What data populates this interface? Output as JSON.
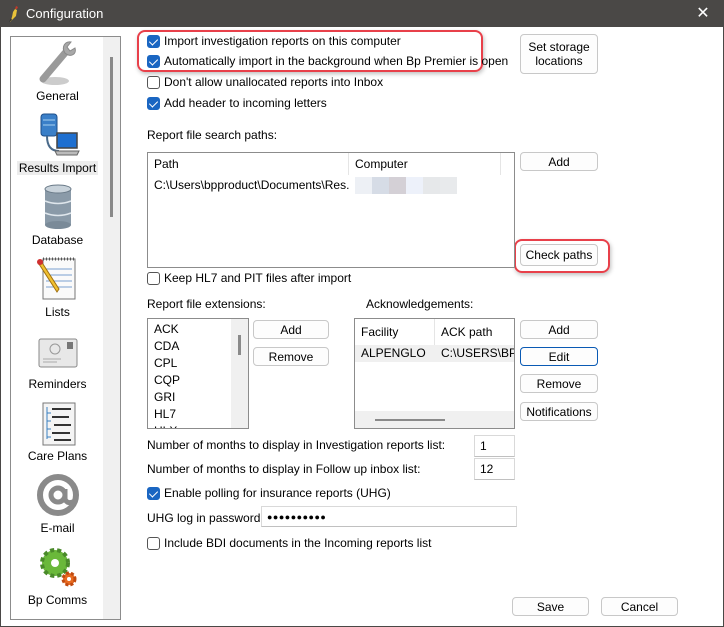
{
  "window": {
    "title": "Configuration",
    "close_glyph": "✕"
  },
  "sidebar": {
    "items": [
      {
        "label": "General",
        "icon": "wrench-icon"
      },
      {
        "label": "Results Import",
        "icon": "server-computer-icon",
        "selected": true
      },
      {
        "label": "Database",
        "icon": "database-icon"
      },
      {
        "label": "Lists",
        "icon": "notepad-pencil-icon"
      },
      {
        "label": "Reminders",
        "icon": "envelope-icon"
      },
      {
        "label": "Care Plans",
        "icon": "tree-document-icon"
      },
      {
        "label": "E-mail",
        "icon": "at-sign-icon"
      },
      {
        "label": "Bp Comms",
        "icon": "gears-icon"
      }
    ]
  },
  "options": {
    "import_on_computer": {
      "label": "Import investigation reports on this computer",
      "checked": true
    },
    "auto_import_background": {
      "label": "Automatically import in the background when Bp Premier is open",
      "checked": true
    },
    "no_unallocated": {
      "label": "Don't allow unallocated reports into Inbox",
      "checked": false
    },
    "add_header": {
      "label": "Add header to incoming letters",
      "checked": true
    },
    "keep_hl7": {
      "label": "Keep HL7 and PIT files after import",
      "checked": false
    },
    "enable_polling": {
      "label": "Enable polling for insurance reports (UHG)",
      "checked": true
    },
    "include_bdi": {
      "label": "Include BDI documents in the Incoming reports list",
      "checked": false
    }
  },
  "buttons": {
    "set_storage": "Set storage locations",
    "paths_add": "Add",
    "check_paths": "Check paths",
    "ext_add": "Add",
    "ext_remove": "Remove",
    "ack_add": "Add",
    "ack_edit": "Edit",
    "ack_remove": "Remove",
    "ack_notifications": "Notifications",
    "save": "Save",
    "cancel": "Cancel"
  },
  "search_paths": {
    "label": "Report file search paths:",
    "columns": [
      "Path",
      "Computer"
    ],
    "rows": [
      {
        "path": "C:\\Users\\bpproduct\\Documents\\Res...",
        "computer": "(redacted)"
      }
    ]
  },
  "extensions": {
    "label": "Report file extensions:",
    "items": [
      "ACK",
      "CDA",
      "CPL",
      "CQP",
      "GRI",
      "HL7",
      "HLX"
    ]
  },
  "acknowledgements": {
    "label": "Acknowledgements:",
    "columns": [
      "Facility",
      "ACK path"
    ],
    "rows": [
      {
        "facility": "ALPENGLO",
        "ack_path": "C:\\USERS\\BP"
      }
    ]
  },
  "months": {
    "investigation_label": "Number of months to display in Investigation reports list:",
    "investigation_value": "1",
    "followup_label": "Number of months to display in Follow up inbox list:",
    "followup_value": "12"
  },
  "uhg": {
    "password_label": "UHG log in password:",
    "password_value": "●●●●●●●●●●"
  },
  "colors": {
    "accent": "#1a66c2",
    "highlight": "#e8404a",
    "titlebar": "#4a4846"
  }
}
